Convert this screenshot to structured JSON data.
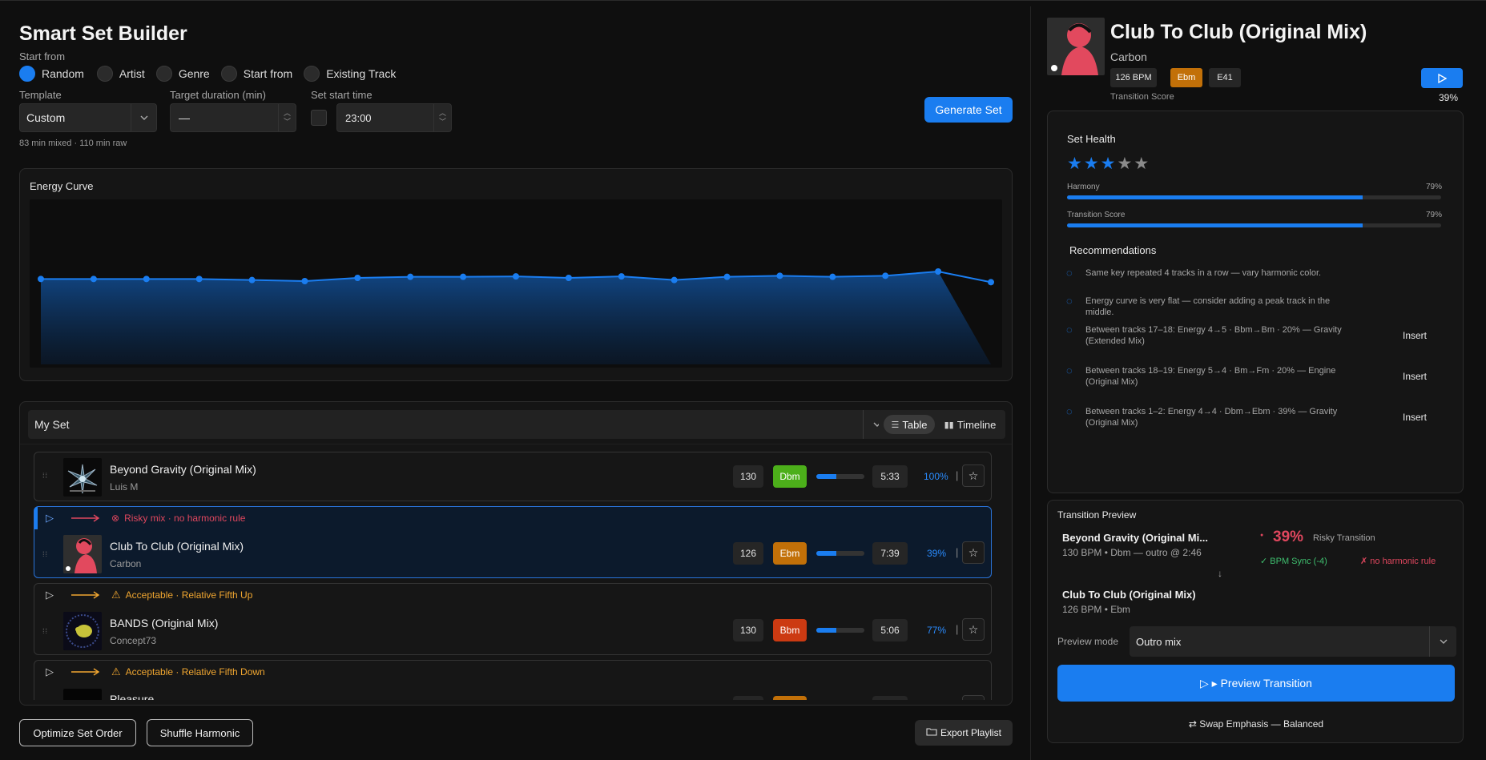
{
  "app": {
    "title": "Smart Set Builder"
  },
  "start_from": {
    "label": "Start from",
    "options": [
      "Random",
      "Artist",
      "Genre",
      "Start from",
      "Existing Track"
    ],
    "selected": "Random"
  },
  "template": {
    "label": "Template",
    "value": "Custom"
  },
  "target_duration": {
    "label": "Target duration (min)",
    "value": "—"
  },
  "set_start_time": {
    "label": "Set start time",
    "value": "23:00",
    "checked": false
  },
  "mix_summary": "83 min mixed · 110 min raw",
  "generate_button": "Generate Set",
  "energy_curve": {
    "title": "Energy Curve"
  },
  "chart_data": {
    "type": "area",
    "title": "Energy Curve",
    "xlabel": "",
    "ylabel": "",
    "x": [
      1,
      2,
      3,
      4,
      5,
      6,
      7,
      8,
      9,
      10,
      11,
      12,
      13,
      14,
      15,
      16,
      17,
      18,
      19
    ],
    "values": [
      4.0,
      4.0,
      4.0,
      4.0,
      3.95,
      3.9,
      4.05,
      4.1,
      4.1,
      4.12,
      4.05,
      4.12,
      3.95,
      4.1,
      4.15,
      4.1,
      4.15,
      4.35,
      3.85
    ],
    "grid": false,
    "legend": "none",
    "colors": {
      "line": "#1a7df0",
      "fill": "#0f3a6e"
    }
  },
  "set_panel": {
    "set_name": "My Set",
    "view_tabs": [
      "Table",
      "Timeline"
    ],
    "active_view": "Table"
  },
  "tracks": [
    {
      "title": "Beyond Gravity (Original Mix)",
      "artist": "Luis M",
      "bpm": "130",
      "key": "Dbm",
      "key_color": "#4caf1a",
      "energy": 0.42,
      "duration": "5:33",
      "score": "100%"
    },
    {
      "title": "Club To Club (Original Mix)",
      "artist": "Carbon",
      "bpm": "126",
      "key": "Ebm",
      "key_color": "#c27008",
      "energy": 0.42,
      "duration": "7:39",
      "score": "39%"
    },
    {
      "title": "BANDS (Original Mix)",
      "artist": "Concept73",
      "bpm": "130",
      "key": "Bbm",
      "key_color": "#cc3a12",
      "energy": 0.42,
      "duration": "5:06",
      "score": "77%"
    },
    {
      "title": "Pleasure",
      "artist": "",
      "bpm": "",
      "key": "",
      "key_color": "#c27008",
      "energy": 0.42,
      "duration": "",
      "score": ""
    }
  ],
  "transitions": [
    {
      "label": "Risky mix · no harmonic rule",
      "color": "#e0475e",
      "arrow_color": "#e0475e"
    },
    {
      "label": "Acceptable · Relative Fifth Up",
      "color": "#f0a630",
      "arrow_color": "#f0a630"
    },
    {
      "label": "Acceptable · Relative Fifth Down",
      "color": "#f0a630",
      "arrow_color": "#f0a630"
    }
  ],
  "bottom_buttons": {
    "optimize": "Optimize Set Order",
    "shuffle": "Shuffle Harmonic",
    "export": "Export Playlist"
  },
  "now_playing": {
    "title": "Club To Club (Original Mix)",
    "artist": "Carbon",
    "bpm": "126 BPM",
    "key": "Ebm",
    "camelot": "E41",
    "score_label": "Transition Score",
    "score": "39%"
  },
  "set_health": {
    "title": "Set Health",
    "rating": 3,
    "rating_max": 5,
    "harmony_label": "Harmony",
    "harmony_pct": "79%",
    "harmony_value": 0.79,
    "transition_label": "Transition Score",
    "transition_pct": "79%",
    "transition_value": 0.79,
    "recommendations_title": "Recommendations",
    "recommendations": [
      {
        "text": "Same key repeated 4 tracks in a row — vary harmonic color.",
        "action": ""
      },
      {
        "text": "Energy curve is very flat — consider adding a peak track in the middle.",
        "action": ""
      },
      {
        "text": "Between tracks 17–18: Energy 4→5 · Bbm→Bm · 20% — Gravity (Extended Mix)",
        "action": "Insert"
      },
      {
        "text": "Between tracks 18–19: Energy 5→4 · Bm→Fm · 20% — Engine (Original Mix)",
        "action": "Insert"
      },
      {
        "text": "Between tracks 1–2: Energy 4→4 · Dbm→Ebm · 39% — Gravity (Original Mix)",
        "action": "Insert"
      }
    ]
  },
  "transition_preview": {
    "title": "Transition Preview",
    "from_title": "Beyond Gravity (Original Mi...",
    "from_meta": "130 BPM • Dbm — outro @ 2:46",
    "arrow": "↓",
    "to_title": "Club To Club (Original Mix)",
    "to_meta": "126 BPM • Ebm",
    "score": "39%",
    "score_label": "Risky Transition",
    "bpm_sync": "✓ BPM Sync (-4)",
    "harmonic": "✗ no harmonic rule",
    "mode_label": "Preview mode",
    "mode_value": "Outro mix",
    "preview_button": "▷ ▸ Preview Transition",
    "swap": "⇄ Swap Emphasis — Balanced"
  }
}
